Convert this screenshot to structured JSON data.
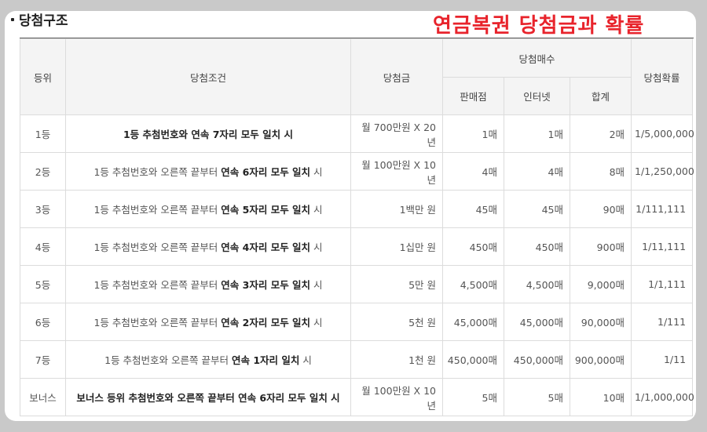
{
  "section_title": "당첨구조",
  "overlay_title": "연금복권 당첨금과 확률",
  "headers": {
    "rank": "등위",
    "condition": "당첨조건",
    "prize": "당첨금",
    "count_group": "당첨매수",
    "store": "판매점",
    "internet": "인터넷",
    "total": "합계",
    "probability": "당첨확률"
  },
  "rows": [
    {
      "rank": "1등",
      "cond_pre": "",
      "cond_bold": "1등 추첨번호와 연속 7자리 모두 일치 시",
      "cond_post": "",
      "prize": "월 700만원 X 20년",
      "store": "1매",
      "internet": "1매",
      "total": "2매",
      "prob": "1/5,000,000"
    },
    {
      "rank": "2등",
      "cond_pre": "1등 추첨번호와 오른쪽 끝부터 ",
      "cond_bold": "연속 6자리 모두 일치",
      "cond_post": " 시",
      "prize": "월 100만원 X 10년",
      "store": "4매",
      "internet": "4매",
      "total": "8매",
      "prob": "1/1,250,000"
    },
    {
      "rank": "3등",
      "cond_pre": "1등 추첨번호와 오른쪽 끝부터 ",
      "cond_bold": "연속 5자리 모두 일치",
      "cond_post": " 시",
      "prize": "1백만 원",
      "store": "45매",
      "internet": "45매",
      "total": "90매",
      "prob": "1/111,111"
    },
    {
      "rank": "4등",
      "cond_pre": "1등 추첨번호와 오른쪽 끝부터 ",
      "cond_bold": "연속 4자리 모두 일치",
      "cond_post": " 시",
      "prize": "1십만 원",
      "store": "450매",
      "internet": "450매",
      "total": "900매",
      "prob": "1/11,111"
    },
    {
      "rank": "5등",
      "cond_pre": "1등 추첨번호와 오른쪽 끝부터 ",
      "cond_bold": "연속 3자리 모두 일치",
      "cond_post": " 시",
      "prize": "5만 원",
      "store": "4,500매",
      "internet": "4,500매",
      "total": "9,000매",
      "prob": "1/1,111"
    },
    {
      "rank": "6등",
      "cond_pre": "1등 추첨번호와 오른쪽 끝부터 ",
      "cond_bold": "연속 2자리 모두 일치",
      "cond_post": " 시",
      "prize": "5천 원",
      "store": "45,000매",
      "internet": "45,000매",
      "total": "90,000매",
      "prob": "1/111"
    },
    {
      "rank": "7등",
      "cond_pre": "1등 추첨번호와 오른쪽 끝부터 ",
      "cond_bold": "연속 1자리 일치",
      "cond_post": " 시",
      "prize": "1천 원",
      "store": "450,000매",
      "internet": "450,000매",
      "total": "900,000매",
      "prob": "1/11"
    },
    {
      "rank": "보너스",
      "cond_pre": "",
      "cond_bold": "보너스 등위 추첨번호와 오른쪽 끝부터 연속 6자리 모두 일치 시",
      "cond_post": "",
      "prize": "월 100만원 X 10년",
      "store": "5매",
      "internet": "5매",
      "total": "10매",
      "prob": "1/1,000,000"
    }
  ]
}
